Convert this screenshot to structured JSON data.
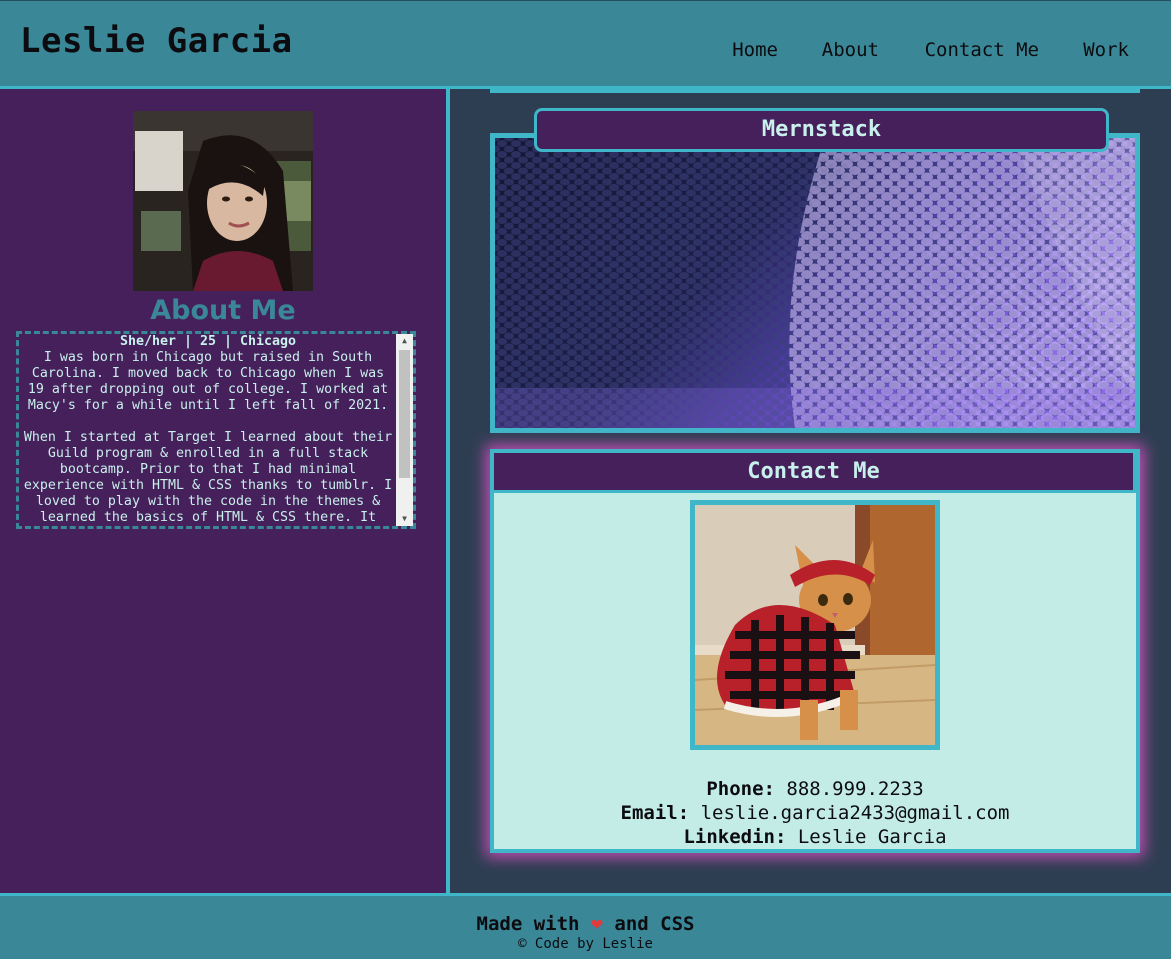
{
  "header": {
    "title": "Leslie Garcia",
    "nav": [
      "Home",
      "About",
      "Contact Me",
      "Work"
    ]
  },
  "about": {
    "heading": "About Me",
    "tagline": "She/her | 25 | Chicago",
    "paragraph1": "I was born in Chicago but raised in South Carolina. I moved back to Chicago when I was 19 after dropping out of college. I worked at Macy's for a while until I left fall of 2021.",
    "paragraph2": "When I started at Target I learned about their Guild program & enrolled in a full stack bootcamp. Prior to that I had minimal experience with HTML & CSS thanks to tumblr. I loved to play with the code in the themes & learned the basics of HTML & CSS there. It"
  },
  "work": {
    "project_label": "Mernstack"
  },
  "contact": {
    "heading": "Contact Me",
    "phone_label": "Phone:",
    "phone": "888.999.2233",
    "email_label": "Email:",
    "email": "leslie.garcia2433@gmail.com",
    "linkedin_label": "Linkedin:",
    "linkedin": "Leslie Garcia"
  },
  "footer": {
    "made_with_prefix": "Made with",
    "heart": "❤",
    "made_with_suffix": "and CSS",
    "copyright": "© Code by Leslie"
  },
  "colors": {
    "teal": "#3a8797",
    "cyan_border": "#3fb7c9",
    "purple": "#45205a",
    "slate": "#2e3e52",
    "mint": "#c4ece6",
    "glow": "#c44fb5"
  }
}
